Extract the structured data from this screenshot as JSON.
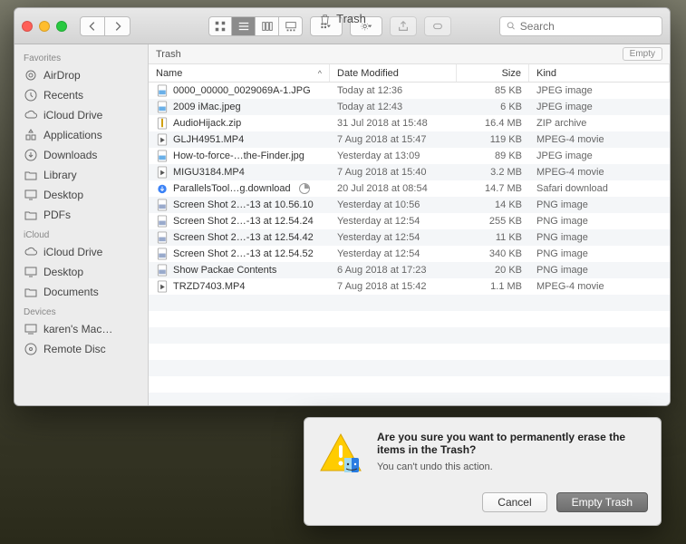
{
  "window": {
    "title": "Trash",
    "search_placeholder": "Search",
    "path_label": "Trash",
    "empty_button": "Empty"
  },
  "sidebar": {
    "sections": [
      {
        "heading": "Favorites",
        "items": [
          {
            "label": "AirDrop",
            "icon": "airdrop"
          },
          {
            "label": "Recents",
            "icon": "clock"
          },
          {
            "label": "iCloud Drive",
            "icon": "cloud"
          },
          {
            "label": "Applications",
            "icon": "apps"
          },
          {
            "label": "Downloads",
            "icon": "download"
          },
          {
            "label": "Library",
            "icon": "folder"
          },
          {
            "label": "Desktop",
            "icon": "desktop"
          },
          {
            "label": "PDFs",
            "icon": "folder"
          }
        ]
      },
      {
        "heading": "iCloud",
        "items": [
          {
            "label": "iCloud Drive",
            "icon": "cloud"
          },
          {
            "label": "Desktop",
            "icon": "desktop"
          },
          {
            "label": "Documents",
            "icon": "folder"
          }
        ]
      },
      {
        "heading": "Devices",
        "items": [
          {
            "label": "karen's Mac…",
            "icon": "computer"
          },
          {
            "label": "Remote Disc",
            "icon": "disc"
          }
        ]
      }
    ]
  },
  "columns": {
    "name": "Name",
    "date": "Date Modified",
    "size": "Size",
    "kind": "Kind",
    "sort_indicator": "^"
  },
  "files": [
    {
      "name": "0000_00000_0029069A-1.JPG",
      "date": "Today at 12:36",
      "size": "85 KB",
      "kind": "JPEG image",
      "icon": "jpg"
    },
    {
      "name": "2009 iMac.jpeg",
      "date": "Today at 12:43",
      "size": "6 KB",
      "kind": "JPEG image",
      "icon": "jpg"
    },
    {
      "name": "AudioHijack.zip",
      "date": "31 Jul 2018 at 15:48",
      "size": "16.4 MB",
      "kind": "ZIP archive",
      "icon": "zip"
    },
    {
      "name": "GLJH4951.MP4",
      "date": "7 Aug 2018 at 15:47",
      "size": "119 KB",
      "kind": "MPEG-4 movie",
      "icon": "mov"
    },
    {
      "name": "How-to-force-…the-Finder.jpg",
      "date": "Yesterday at 13:09",
      "size": "89 KB",
      "kind": "JPEG image",
      "icon": "jpg"
    },
    {
      "name": "MIGU3184.MP4",
      "date": "7 Aug 2018 at 15:40",
      "size": "3.2 MB",
      "kind": "MPEG-4 movie",
      "icon": "mov"
    },
    {
      "name": "ParallelsTool…g.download",
      "date": "20 Jul 2018 at 08:54",
      "size": "14.7 MB",
      "kind": "Safari download",
      "icon": "dl",
      "progress": true
    },
    {
      "name": "Screen Shot 2…-13 at 10.56.10",
      "date": "Yesterday at 10:56",
      "size": "14 KB",
      "kind": "PNG image",
      "icon": "png"
    },
    {
      "name": "Screen Shot 2…-13 at 12.54.24",
      "date": "Yesterday at 12:54",
      "size": "255 KB",
      "kind": "PNG image",
      "icon": "png"
    },
    {
      "name": "Screen Shot 2…-13 at 12.54.42",
      "date": "Yesterday at 12:54",
      "size": "11 KB",
      "kind": "PNG image",
      "icon": "png"
    },
    {
      "name": "Screen Shot 2…-13 at 12.54.52",
      "date": "Yesterday at 12:54",
      "size": "340 KB",
      "kind": "PNG image",
      "icon": "png"
    },
    {
      "name": "Show Packae Contents",
      "date": "6 Aug 2018 at 17:23",
      "size": "20 KB",
      "kind": "PNG image",
      "icon": "png"
    },
    {
      "name": "TRZD7403.MP4",
      "date": "7 Aug 2018 at 15:42",
      "size": "1.1 MB",
      "kind": "MPEG-4 movie",
      "icon": "mov"
    }
  ],
  "dialog": {
    "title": "Are you sure you want to permanently erase the items in the Trash?",
    "subtitle": "You can't undo this action.",
    "cancel": "Cancel",
    "confirm": "Empty Trash"
  }
}
